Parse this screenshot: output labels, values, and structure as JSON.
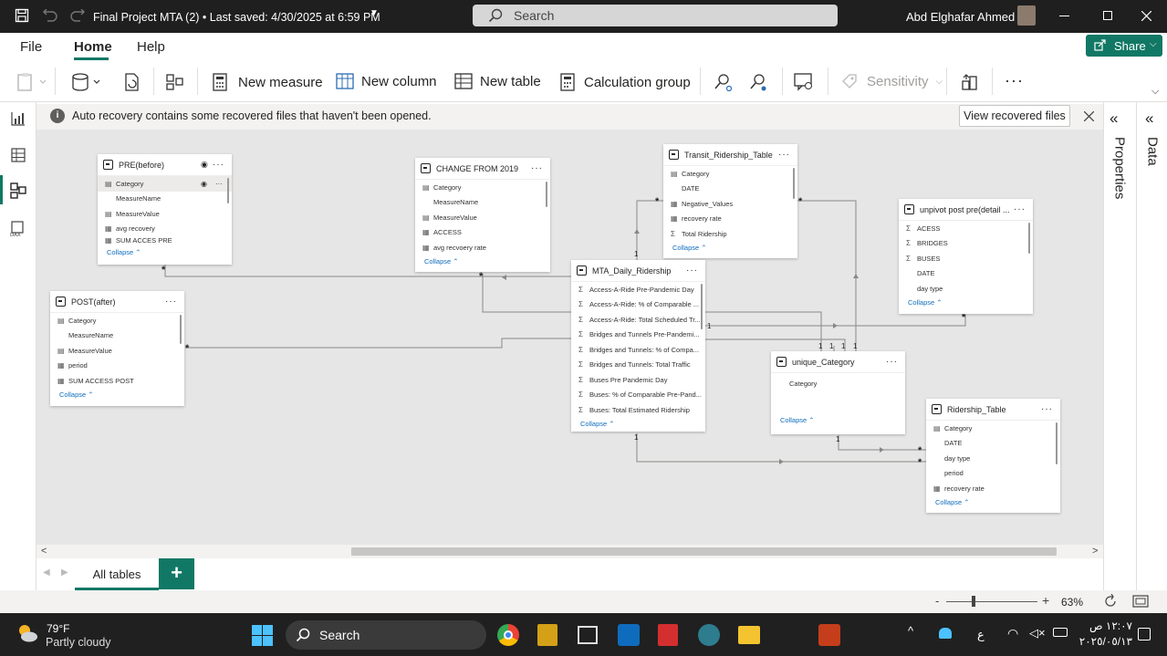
{
  "titlebar": {
    "doc_title": "Final Project MTA (2) • Last saved: 4/30/2025 at 6:59 PM",
    "search_placeholder": "Search",
    "user_name": "Abd Elghafar Ahmed"
  },
  "menu": {
    "file": "File",
    "home": "Home",
    "help": "Help",
    "share": "Share"
  },
  "ribbon": {
    "new_measure": "New measure",
    "new_column": "New column",
    "new_table": "New table",
    "calculation_group": "Calculation group",
    "sensitivity": "Sensitivity"
  },
  "notification": {
    "message": "Auto recovery contains some recovered files that haven't been opened.",
    "view_button": "View recovered files"
  },
  "right_pane": {
    "properties": "Properties",
    "data": "Data"
  },
  "tables": {
    "pre": {
      "title": "PRE(before)",
      "fields": [
        "Category",
        "MeasureName",
        "MeasureValue",
        "avg recovery",
        "SUM ACCES PRE"
      ],
      "collapse": "Collapse"
    },
    "post": {
      "title": "POST(after)",
      "fields": [
        "Category",
        "MeasureName",
        "MeasureValue",
        "period",
        "SUM ACCESS POST"
      ],
      "collapse": "Collapse"
    },
    "change": {
      "title": "CHANGE FROM 2019",
      "fields": [
        "Category",
        "MeasureName",
        "MeasureValue",
        "ACCESS",
        "avg recvoery rate"
      ],
      "collapse": "Collapse"
    },
    "transit": {
      "title": "Transit_Ridership_Table",
      "fields": [
        "Category",
        "DATE",
        "Negative_Values",
        "recovery rate",
        "Total Ridership"
      ],
      "collapse": "Collapse"
    },
    "mta": {
      "title": "MTA_Daily_Ridership",
      "fields": [
        "Access-A-Ride Pre-Pandemic Day",
        "Access-A-Ride: % of Comparable ...",
        "Access-A-Ride: Total Scheduled Tr...",
        "Bridges and Tunnels Pre-Pandemi...",
        "Bridges and Tunnels: % of Compa...",
        "Bridges and Tunnels: Total Traffic",
        "Buses Pre Pandemic Day",
        "Buses: % of Comparable Pre-Pand...",
        "Buses: Total Estimated Ridership"
      ],
      "collapse": "Collapse"
    },
    "unpivot": {
      "title": "unpivot post pre(detail ...",
      "fields": [
        "ACESS",
        "BRIDGES",
        "BUSES",
        "DATE",
        "day type"
      ],
      "collapse": "Collapse"
    },
    "unique": {
      "title": "unique_Category",
      "fields": [
        "Category"
      ],
      "collapse": "Collapse"
    },
    "ridership": {
      "title": "Ridership_Table",
      "fields": [
        "Category",
        "DATE",
        "day type",
        "period",
        "recovery rate"
      ],
      "collapse": "Collapse"
    }
  },
  "cardinality": {
    "many": "*",
    "one": "1"
  },
  "bottom": {
    "tab_all_tables": "All tables",
    "add_tab": "+",
    "zoom": "63%"
  },
  "taskbar": {
    "temp": "79°F",
    "weather": "Partly cloudy",
    "search": "Search",
    "lang": "ع",
    "time": "١٢:٠٧ ص",
    "date": "٢٠٢٥/٠٥/١٣"
  },
  "colors": {
    "accent": "#117865",
    "title_bg": "#1f1f1f",
    "canvas": "#e6e6e6",
    "link": "#0f6cbd"
  }
}
